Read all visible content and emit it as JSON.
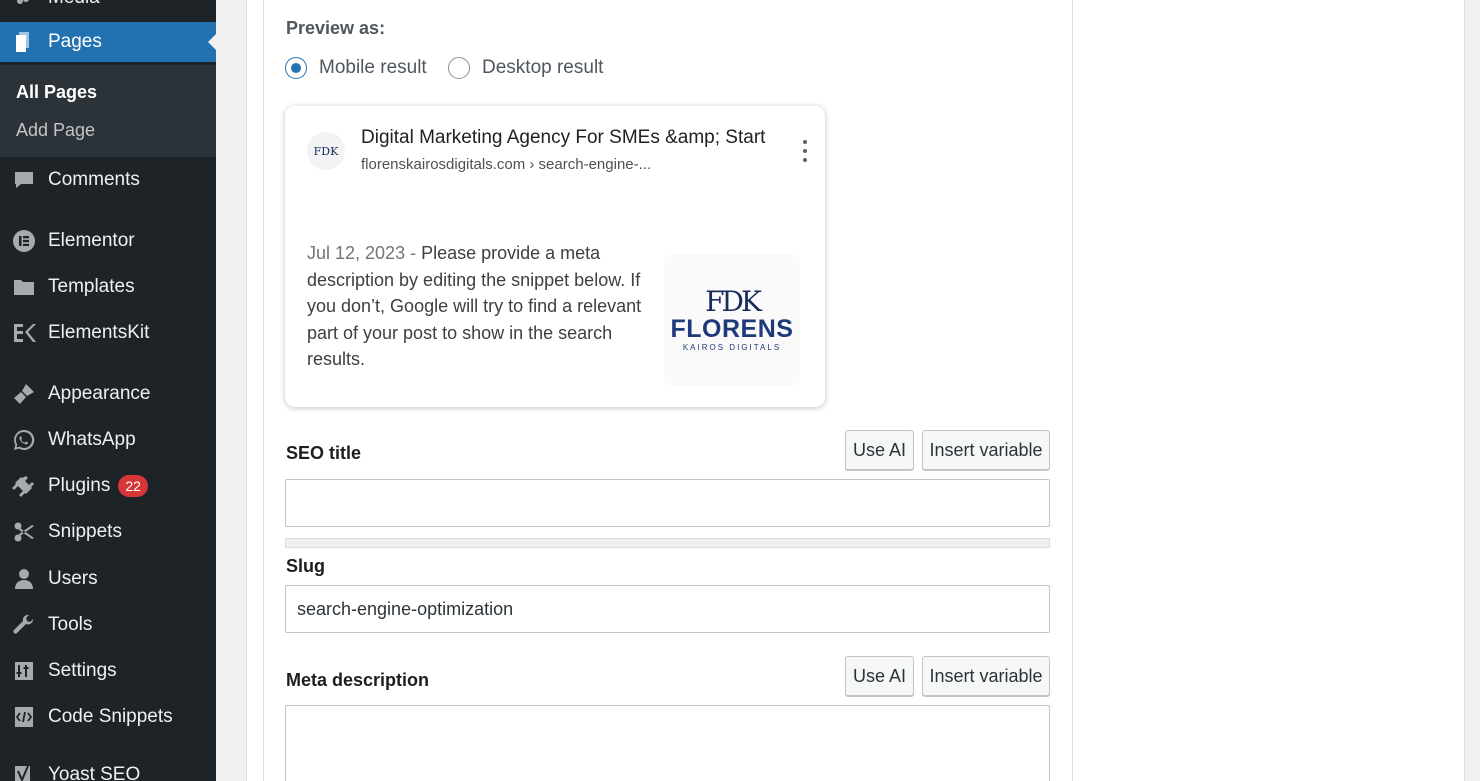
{
  "sidebar": {
    "items": [
      {
        "label": "Media",
        "icon": "media-icon"
      },
      {
        "label": "Pages",
        "icon": "pages-icon",
        "current": true
      },
      {
        "label": "Comments",
        "icon": "comments-icon"
      },
      {
        "label": "Elementor",
        "icon": "elementor-icon"
      },
      {
        "label": "Templates",
        "icon": "folder-icon"
      },
      {
        "label": "ElementsKit",
        "icon": "elementskit-icon"
      },
      {
        "label": "Appearance",
        "icon": "paintbrush-icon"
      },
      {
        "label": "WhatsApp",
        "icon": "whatsapp-icon"
      },
      {
        "label": "Plugins",
        "icon": "plugin-icon",
        "badge": "22"
      },
      {
        "label": "Snippets",
        "icon": "scissors-icon"
      },
      {
        "label": "Users",
        "icon": "users-icon"
      },
      {
        "label": "Tools",
        "icon": "wrench-icon"
      },
      {
        "label": "Settings",
        "icon": "settings-icon"
      },
      {
        "label": "Code Snippets",
        "icon": "code-icon"
      },
      {
        "label": "Yoast SEO",
        "icon": "yoast-icon"
      }
    ],
    "submenu": [
      {
        "label": "All Pages",
        "active": true
      },
      {
        "label": "Add Page"
      }
    ]
  },
  "preview": {
    "heading": "Preview as:",
    "options": [
      {
        "label": "Mobile result",
        "checked": true
      },
      {
        "label": "Desktop result",
        "checked": false
      }
    ]
  },
  "serp": {
    "favicon_text": "FDK",
    "title": "Digital Marketing Agency For SMEs &amp; Startups",
    "url": "florenskairosdigitals.com › search-engine-...",
    "date": "Jul 12, 2023",
    "separator": " - ",
    "description": "Please provide a meta description by editing the snippet below. If you don’t, Google will try to find a relevant part of your post to show in the search results.",
    "thumb_mark": "FDK",
    "thumb_name": "FLORENS",
    "thumb_sub": "KAIROS DIGITALS"
  },
  "seo_title": {
    "label": "SEO title",
    "use_ai": "Use AI",
    "insert_variable": "Insert variable",
    "value": ""
  },
  "slug": {
    "label": "Slug",
    "value": "search-engine-optimization"
  },
  "meta_description": {
    "label": "Meta description",
    "use_ai": "Use AI",
    "insert_variable": "Insert variable",
    "value": ""
  },
  "colors": {
    "sidebar_bg": "#1d2327",
    "accent": "#2271b1",
    "badge": "#d63638"
  }
}
